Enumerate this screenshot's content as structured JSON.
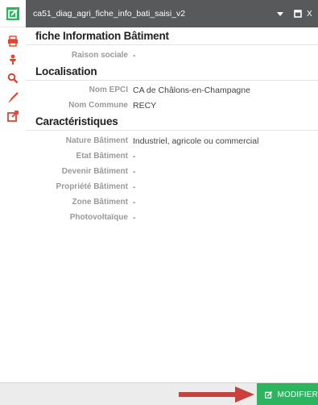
{
  "header": {
    "title": "ca51_diag_agri_fiche_info_bati_saisi_v2",
    "close_label": "X"
  },
  "colors": {
    "header_bg": "#58595b",
    "accent_green": "#2cb45e",
    "toolbar_red": "#e8412e",
    "arrow_red": "#c8413a"
  },
  "toolbar": {
    "icons": [
      "edit-icon",
      "printer-icon",
      "person-icon",
      "search-icon",
      "paintbrush-icon",
      "external-link-icon"
    ]
  },
  "sections": {
    "fiche": {
      "title": "fiche Information Bâtiment",
      "rows": [
        {
          "label": "Raison sociale",
          "value": "-"
        }
      ]
    },
    "localisation": {
      "title": "Localisation",
      "rows": [
        {
          "label": "Nom EPCI",
          "value": "CA de Châlons-en-Champagne"
        },
        {
          "label": "Nom Commune",
          "value": "RECY"
        }
      ]
    },
    "caracteristiques": {
      "title": "Caractéristiques",
      "rows": [
        {
          "label": "Nature Bâtiment",
          "value": "Industriel, agricole ou commercial"
        },
        {
          "label": "Etat Bâtiment",
          "value": "-"
        },
        {
          "label": "Devenir Bâtiment",
          "value": "-"
        },
        {
          "label": "Propriété Bâtiment",
          "value": "-"
        },
        {
          "label": "Zone Bâtiment",
          "value": "-"
        },
        {
          "label": "Photovoltaïque",
          "value": "-"
        }
      ]
    }
  },
  "footer": {
    "modify_label": "MODIFIER"
  }
}
